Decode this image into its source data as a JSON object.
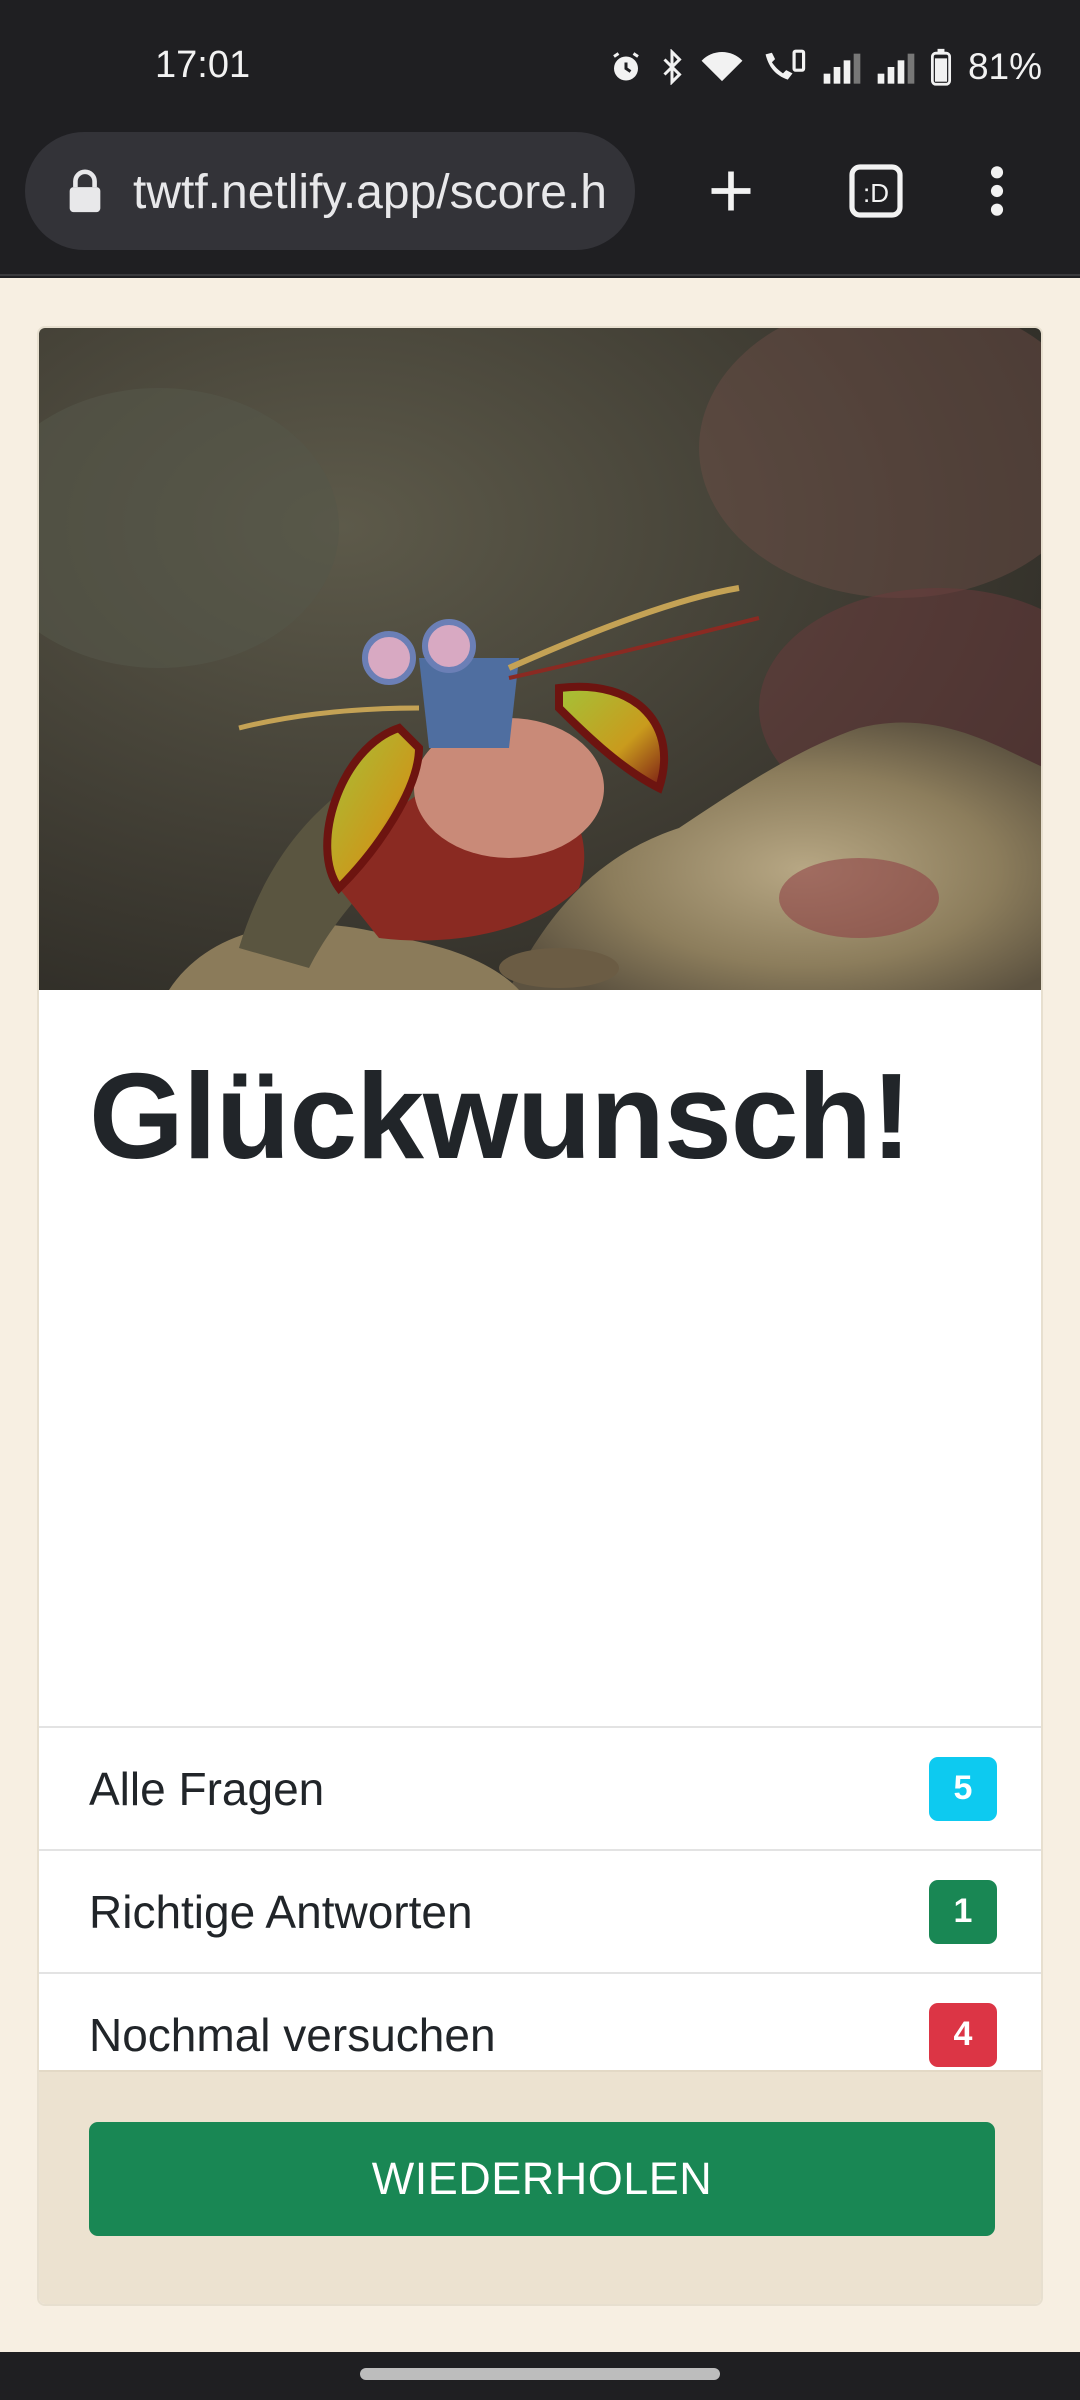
{
  "status_bar": {
    "time": "17:01",
    "battery_percent": "81%",
    "icons": [
      "alarm-icon",
      "bluetooth-icon",
      "wifi-icon",
      "wifi-call-icon",
      "signal-icon",
      "signal-icon",
      "battery-icon"
    ]
  },
  "browser": {
    "url": "twtf.netlify.app/score.h",
    "tab_count": ":D",
    "icons": [
      "lock-icon",
      "new-tab-plus-icon",
      "tab-switcher-icon",
      "overflow-menu-icon"
    ]
  },
  "card": {
    "image": "mantis-shrimp-photo",
    "title": "Glückwunsch!",
    "stats": [
      {
        "label": "Alle Fragen",
        "value": "5",
        "color": "#0dcaf0"
      },
      {
        "label": "Richtige Antworten",
        "value": "1",
        "color": "#198754"
      },
      {
        "label": "Nochmal versuchen",
        "value": "4",
        "color": "#dc3545"
      }
    ],
    "button_label": "WIEDERHOLEN"
  },
  "colors": {
    "page_background": "#f7efe2",
    "footer_background": "#ece2d0",
    "primary_button": "#198754"
  }
}
